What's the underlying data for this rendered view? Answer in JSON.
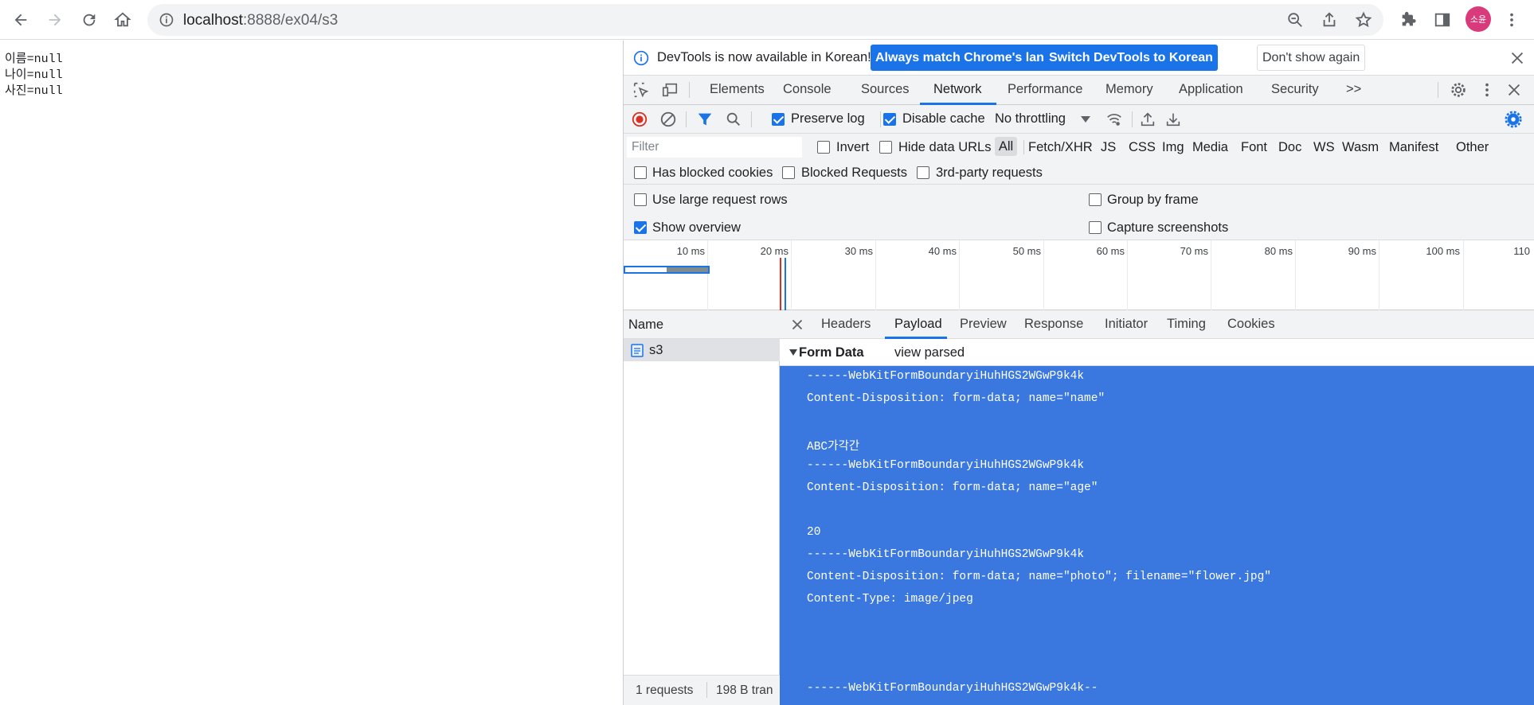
{
  "browser": {
    "url_host": "localhost",
    "url_path": ":8888/ex04/s3",
    "profile_initials": "소윤"
  },
  "page": {
    "lines": [
      "이름=null",
      "나이=null",
      "사진=null"
    ]
  },
  "devtools": {
    "infobar": {
      "message": "DevTools is now available in Korean!",
      "btn_match": "Always match Chrome's language",
      "btn_switch": "Switch DevTools to Korean",
      "btn_dismiss": "Don't show again"
    },
    "tabs": [
      "Elements",
      "Console",
      "Sources",
      "Network",
      "Performance",
      "Memory",
      "Application",
      "Security"
    ],
    "more_tabs": ">>",
    "network_toolbar": {
      "preserve_log": "Preserve log",
      "disable_cache": "Disable cache",
      "throttling": "No throttling"
    },
    "filter": {
      "placeholder": "Filter",
      "invert": "Invert",
      "hide_data_urls": "Hide data URLs",
      "types": [
        "All",
        "Fetch/XHR",
        "JS",
        "CSS",
        "Img",
        "Media",
        "Font",
        "Doc",
        "WS",
        "Wasm",
        "Manifest",
        "Other"
      ],
      "has_blocked_cookies": "Has blocked cookies",
      "blocked_requests": "Blocked Requests",
      "third_party": "3rd-party requests"
    },
    "settings": {
      "large_rows": "Use large request rows",
      "group_by_frame": "Group by frame",
      "show_overview": "Show overview",
      "capture_screenshots": "Capture screenshots"
    },
    "overview_ticks": [
      "10 ms",
      "20 ms",
      "30 ms",
      "40 ms",
      "50 ms",
      "60 ms",
      "70 ms",
      "80 ms",
      "90 ms",
      "100 ms",
      "110"
    ],
    "requests": {
      "name_header": "Name",
      "items": [
        "s3"
      ],
      "status_count": "1 requests",
      "status_transfer": "198 B tran"
    },
    "detail_tabs": [
      "Headers",
      "Payload",
      "Preview",
      "Response",
      "Initiator",
      "Timing",
      "Cookies"
    ],
    "form_data": {
      "title": "Form Data",
      "view_toggle": "view parsed",
      "lines": [
        "------WebKitFormBoundaryiHuhHGS2WGwP9k4k",
        "Content-Disposition: form-data; name=\"name\"",
        "",
        "ABC가각간",
        "------WebKitFormBoundaryiHuhHGS2WGwP9k4k",
        "Content-Disposition: form-data; name=\"age\"",
        "",
        "20",
        "------WebKitFormBoundaryiHuhHGS2WGwP9k4k",
        "Content-Disposition: form-data; name=\"photo\"; filename=\"flower.jpg\"",
        "Content-Type: image/jpeg",
        "",
        "",
        "",
        "------WebKitFormBoundaryiHuhHGS2WGwP9k4k--"
      ]
    }
  }
}
